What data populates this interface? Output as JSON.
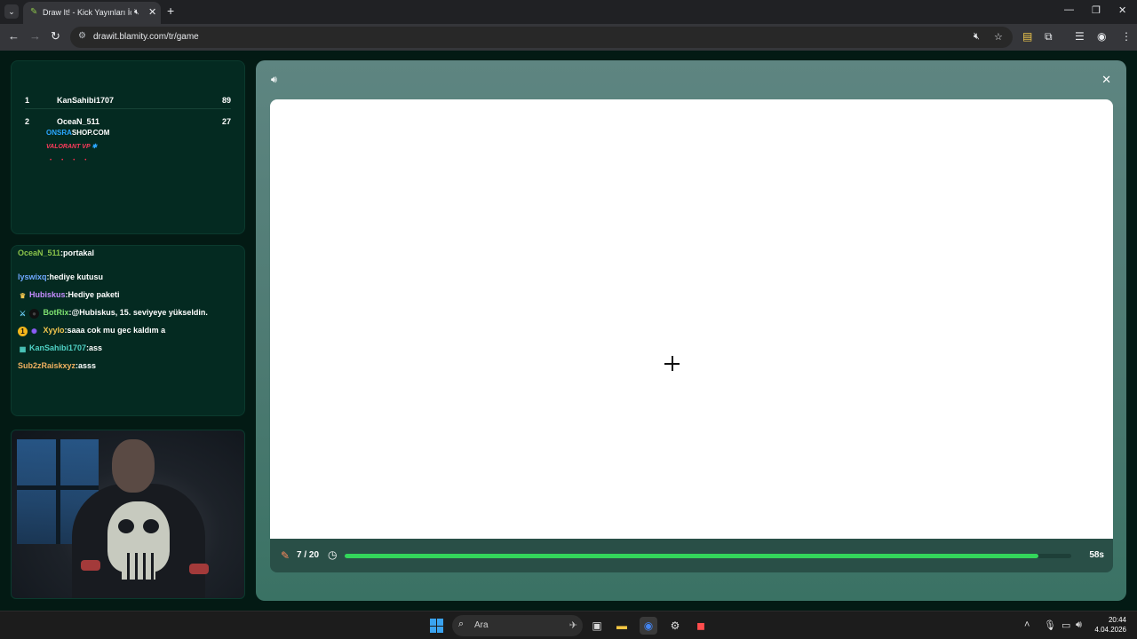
{
  "browser": {
    "tab_title": "Draw It! - Kick Yayınları İçin",
    "url": "drawit.blamity.com/tr/game",
    "new_tab": "+",
    "tab_close": "✕"
  },
  "leaderboard": {
    "entries": [
      {
        "rank": "1",
        "name": "KanSahibi1707",
        "score": "89"
      },
      {
        "rank": "2",
        "name": "OceaN_511",
        "score": "27"
      }
    ],
    "ad": {
      "brand_accent": "ONSRA",
      "brand_rest": "SHOP.COM",
      "product": "VALORANT VP"
    }
  },
  "chat": {
    "messages": [
      {
        "user": "OceaN_511",
        "text": "portakal",
        "color": "#8bc34a"
      },
      {
        "user": "lyswixq",
        "text": "hediye kutusu",
        "color": "#6fa8ff"
      },
      {
        "user": "Hubiskus",
        "text": "Hediye paketi",
        "color": "#c58cff"
      },
      {
        "user": "BotRix",
        "text": "@Hubiskus, 15. seviyeye yükseldin.",
        "color": "#7ee070"
      },
      {
        "user": "Xyylo",
        "text": "saaa cok mu gec kaldım a",
        "color": "#f3c74f"
      },
      {
        "user": "KanSahibi1707",
        "text": "ass",
        "color": "#4fd1c5"
      },
      {
        "user": "Sub2zRaiskxyz",
        "text": "asss",
        "color": "#f0b060"
      }
    ]
  },
  "game": {
    "round": "7 / 20",
    "time_left": "58s",
    "progress": 0.955,
    "progress_color": "#33d65b"
  },
  "taskbar": {
    "search_placeholder": "Ara",
    "time": "20:44",
    "date": "4.04.2026"
  }
}
